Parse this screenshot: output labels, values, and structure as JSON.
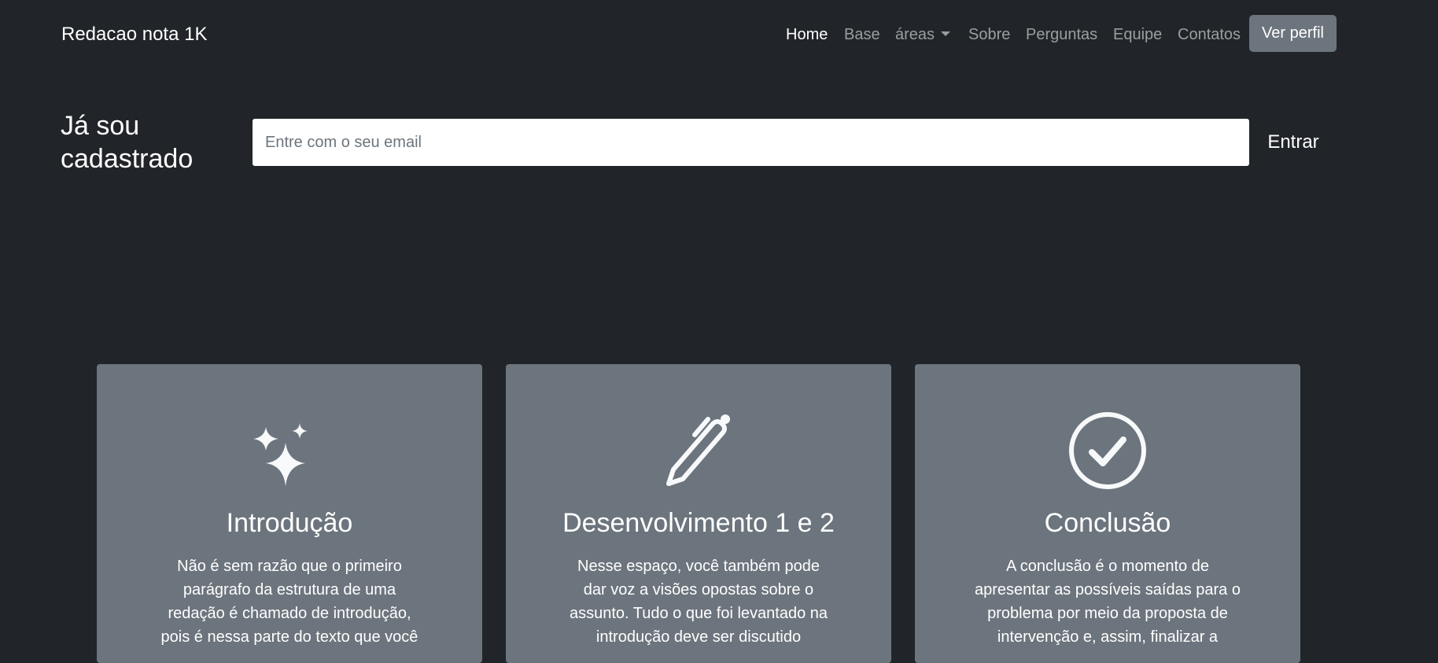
{
  "navbar": {
    "brand": "Redacao nota 1K",
    "items": [
      {
        "label": "Home",
        "active": true
      },
      {
        "label": "Base",
        "active": false
      },
      {
        "label": "áreas",
        "active": false,
        "dropdown": true
      },
      {
        "label": "Sobre",
        "active": false
      },
      {
        "label": "Perguntas",
        "active": false
      },
      {
        "label": "Equipe",
        "active": false
      },
      {
        "label": "Contatos",
        "active": false
      }
    ],
    "profile_button": "Ver perfil"
  },
  "login": {
    "title": "Já sou cadastrado",
    "email_placeholder": "Entre com o seu email",
    "email_value": "",
    "submit_label": "Entrar"
  },
  "cards": [
    {
      "icon": "sparkles-icon",
      "title": "Introdução",
      "text": "Não é sem razão que o primeiro parágrafo da estrutura de uma redação é chamado de introdução, pois é nessa parte do texto que você"
    },
    {
      "icon": "pen-icon",
      "title": "Desenvolvimento 1 e 2",
      "text": "Nesse espaço, você também pode dar voz a visões opostas sobre o assunto. Tudo o que foi levantado na introdução deve ser discutido"
    },
    {
      "icon": "check-circle-icon",
      "title": "Conclusão",
      "text": "A conclusão é o momento de apresentar as possíveis saídas para o problema por meio da proposta de intervenção e, assim, finalizar a"
    }
  ],
  "colors": {
    "background": "#212529",
    "card": "#6c757d",
    "button": "#6c757d",
    "text": "#ffffff",
    "nav_inactive": "rgba(255,255,255,0.55)"
  }
}
